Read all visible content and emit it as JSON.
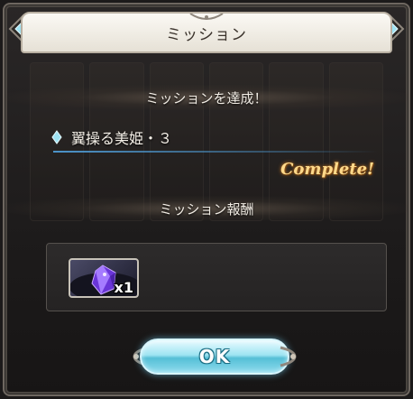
{
  "dialog": {
    "title": "ミッション",
    "achieved_heading": "ミッションを達成！",
    "mission_name": "翼操る美姫・３",
    "complete_label": "Complete!",
    "reward_heading": "ミッション報酬",
    "reward": {
      "icon": "purple-crystal-icon",
      "quantity": "x1"
    },
    "ok_label": "OK"
  },
  "colors": {
    "title_bar": "#f0ece3",
    "accent_blue": "#55bfd6",
    "complete_gold": "#ffd98a",
    "crystal_purple": "#8a4cff"
  }
}
